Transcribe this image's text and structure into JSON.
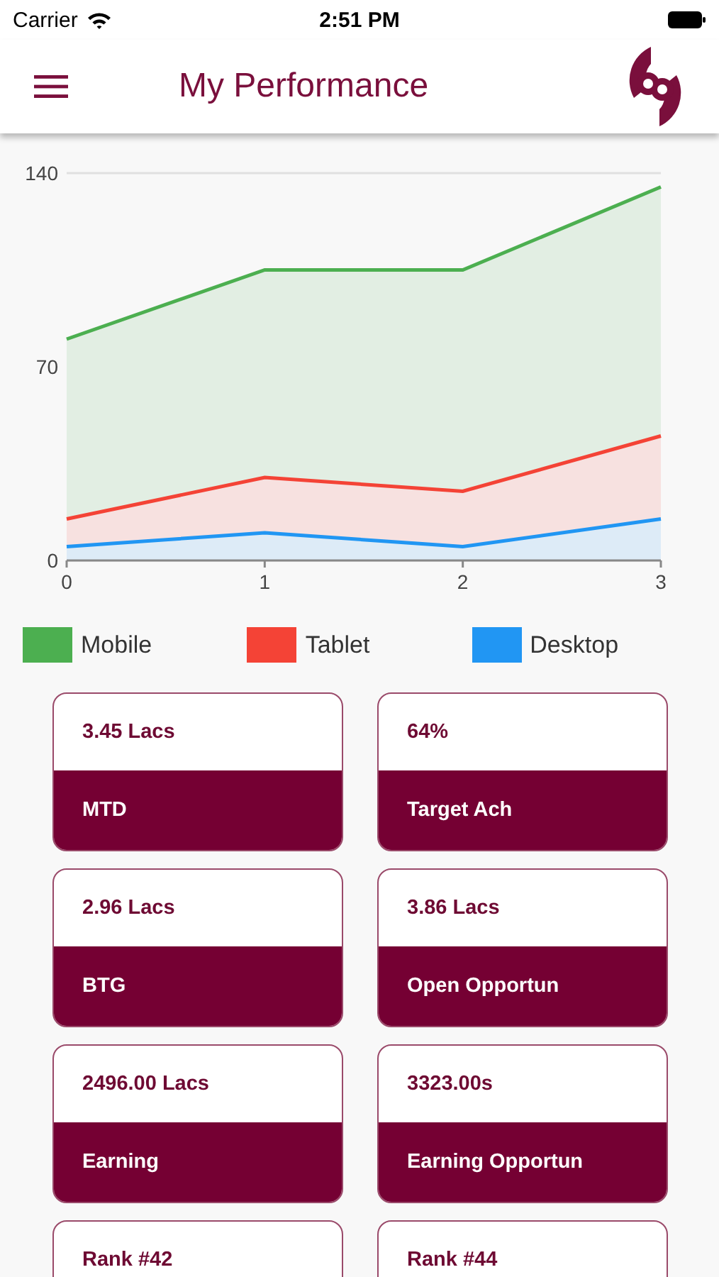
{
  "status_bar": {
    "carrier": "Carrier",
    "time": "2:51 PM"
  },
  "header": {
    "title": "My Performance"
  },
  "chart_data": {
    "type": "area",
    "x": [
      0,
      1,
      2,
      3
    ],
    "xticks": [
      0,
      1,
      2,
      3
    ],
    "yticks": [
      0,
      70,
      140
    ],
    "ylim": [
      0,
      140
    ],
    "xlim": [
      0,
      3
    ],
    "legend": true,
    "series": [
      {
        "name": "Mobile",
        "color": "#4caf50",
        "values": [
          80,
          105,
          105,
          135
        ]
      },
      {
        "name": "Tablet",
        "color": "#f44336",
        "values": [
          15,
          30,
          25,
          45
        ]
      },
      {
        "name": "Desktop",
        "color": "#2196f3",
        "values": [
          5,
          10,
          5,
          15
        ]
      }
    ]
  },
  "cards": [
    {
      "value": "3.45 Lacs",
      "label": "MTD"
    },
    {
      "value": "64%",
      "label": "Target Ach"
    },
    {
      "value": "2.96 Lacs",
      "label": "BTG"
    },
    {
      "value": "3.86 Lacs",
      "label": "Open Opportun"
    },
    {
      "value": "2496.00 Lacs",
      "label": "Earning"
    },
    {
      "value": "3323.00s",
      "label": "Earning Opportun"
    },
    {
      "value": "Rank #42"
    },
    {
      "value": "Rank #44"
    }
  ]
}
